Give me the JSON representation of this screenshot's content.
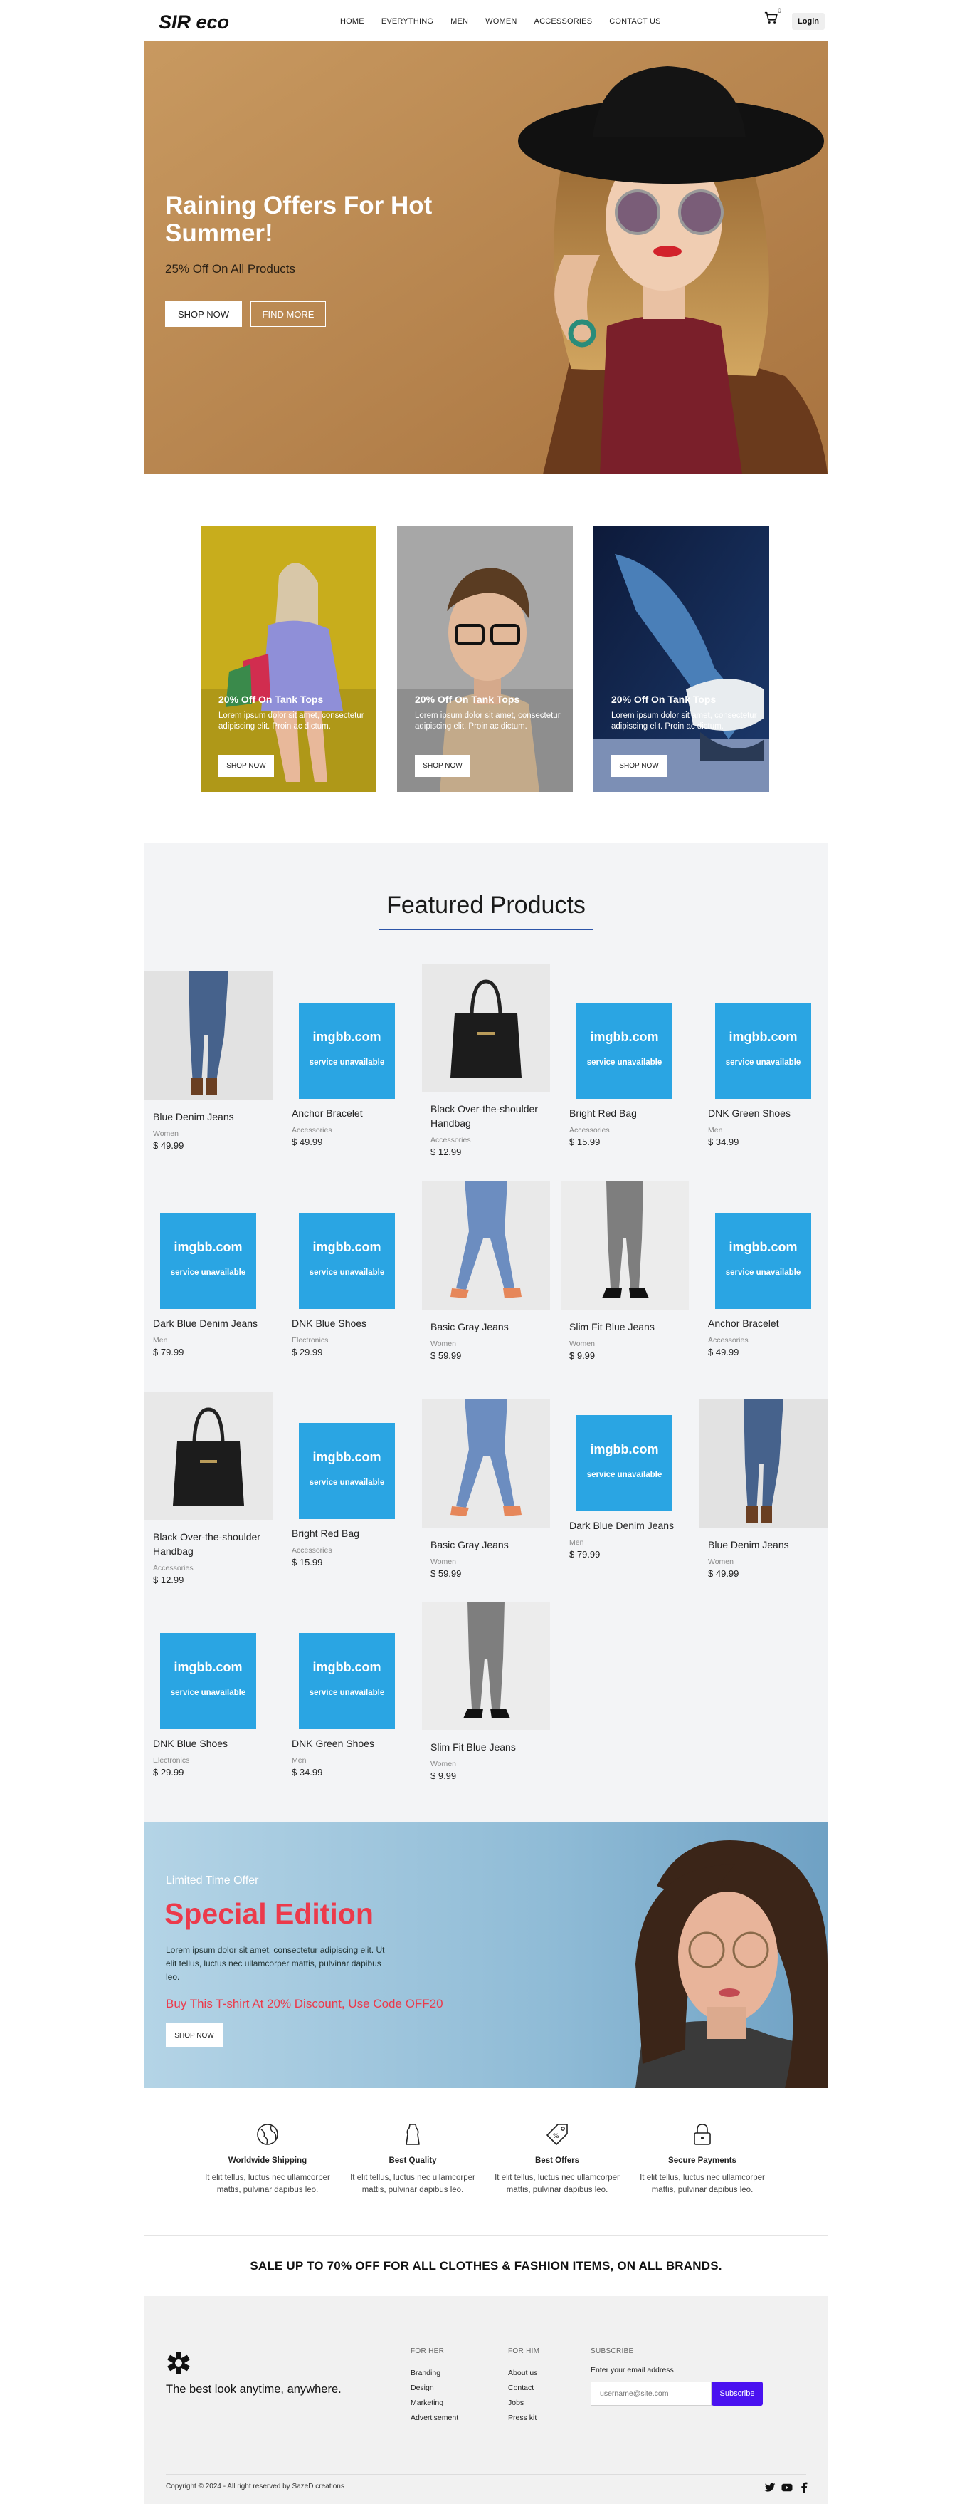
{
  "nav": {
    "logo": "SIR eco",
    "menu": [
      "HOME",
      "EVERYTHING",
      "MEN",
      "WOMEN",
      "ACCESSORIES",
      "CONTACT US"
    ],
    "cart_count": "0",
    "login": "Login"
  },
  "hero": {
    "title": "Raining Offers For Hot Summer!",
    "subtitle": "25% Off On All Products",
    "shop_now": "SHOP NOW",
    "find_more": "FIND MORE"
  },
  "promos": [
    {
      "title": "20% Off On Tank Tops",
      "text": "Lorem ipsum dolor sit amet, consectetur adipiscing elit. Proin ac dictum.",
      "button": "SHOP NOW"
    },
    {
      "title": "20% Off On Tank Tops",
      "text": "Lorem ipsum dolor sit amet, consectetur adipiscing elit. Proin ac dictum.",
      "button": "SHOP NOW"
    },
    {
      "title": "20% Off On Tank Tops",
      "text": "Lorem ipsum dolor sit amet, consectetur adipiscing elit. Proin ac dictum.",
      "button": "SHOP NOW"
    }
  ],
  "featured": {
    "title": "Featured Products",
    "placeholder_line1": "imgbb.com",
    "placeholder_line2": "service unavailable",
    "products": [
      {
        "name": "Blue Denim Jeans",
        "category": "Women",
        "price": "$ 49.99",
        "image": "jeans-brown-boots"
      },
      {
        "name": "Anchor Bracelet",
        "category": "Accessories",
        "price": "$ 49.99",
        "image": "placeholder"
      },
      {
        "name": "Black Over-the-shoulder Handbag",
        "category": "Accessories",
        "price": "$ 12.99",
        "image": "black-handbag"
      },
      {
        "name": "Bright Red Bag",
        "category": "Accessories",
        "price": "$ 15.99",
        "image": "placeholder"
      },
      {
        "name": "DNK Green Shoes",
        "category": "Men",
        "price": "$ 34.99",
        "image": "placeholder"
      },
      {
        "name": "Dark Blue Denim Jeans",
        "category": "Men",
        "price": "$ 79.99",
        "image": "placeholder"
      },
      {
        "name": "DNK Blue Shoes",
        "category": "Electronics",
        "price": "$ 29.99",
        "image": "placeholder"
      },
      {
        "name": "Basic Gray Jeans",
        "category": "Women",
        "price": "$ 59.99",
        "image": "jeans-orange-heels"
      },
      {
        "name": "Slim Fit Blue Jeans",
        "category": "Women",
        "price": "$ 9.99",
        "image": "gray-jeans-black-heels"
      },
      {
        "name": "Anchor Bracelet",
        "category": "Accessories",
        "price": "$ 49.99",
        "image": "placeholder"
      },
      {
        "name": "Black Over-the-shoulder Handbag",
        "category": "Accessories",
        "price": "$ 12.99",
        "image": "black-handbag"
      },
      {
        "name": "Bright Red Bag",
        "category": "Accessories",
        "price": "$ 15.99",
        "image": "placeholder"
      },
      {
        "name": "Basic Gray Jeans",
        "category": "Women",
        "price": "$ 59.99",
        "image": "jeans-orange-heels"
      },
      {
        "name": "Dark Blue Denim Jeans",
        "category": "Men",
        "price": "$ 79.99",
        "image": "placeholder"
      },
      {
        "name": "Blue Denim Jeans",
        "category": "Women",
        "price": "$ 49.99",
        "image": "jeans-brown-boots"
      },
      {
        "name": "DNK Blue Shoes",
        "category": "Electronics",
        "price": "$ 29.99",
        "image": "placeholder"
      },
      {
        "name": "DNK Green Shoes",
        "category": "Men",
        "price": "$ 34.99",
        "image": "placeholder"
      },
      {
        "name": "Slim Fit Blue Jeans",
        "category": "Women",
        "price": "$ 9.99",
        "image": "gray-jeans-black-heels"
      }
    ]
  },
  "special": {
    "limited": "Limited Time Offer",
    "title": "Special Edition",
    "text": "Lorem ipsum dolor sit amet, consectetur adipiscing elit. Ut elit tellus, luctus nec ullamcorper mattis, pulvinar dapibus leo.",
    "offer": "Buy This T-shirt At 20% Discount, Use Code OFF20",
    "button": "SHOP NOW"
  },
  "features": [
    {
      "icon": "globe-icon",
      "title": "Worldwide Shipping",
      "text": "It elit tellus, luctus nec ullamcorper mattis, pulvinar dapibus leo."
    },
    {
      "icon": "shirt-icon",
      "title": "Best Quality",
      "text": "It elit tellus, luctus nec ullamcorper mattis, pulvinar dapibus leo."
    },
    {
      "icon": "tag-icon",
      "title": "Best Offers",
      "text": "It elit tellus, luctus nec ullamcorper mattis, pulvinar dapibus leo."
    },
    {
      "icon": "lock-icon",
      "title": "Secure Payments",
      "text": "It elit tellus, luctus nec ullamcorper mattis, pulvinar dapibus leo."
    }
  ],
  "sale_banner": "SALE UP TO 70% OFF FOR ALL CLOTHES & FASHION ITEMS, ON ALL BRANDS.",
  "footer": {
    "tagline": "The best look anytime, anywhere.",
    "for_her": {
      "heading": "FOR HER",
      "links": [
        "Branding",
        "Design",
        "Marketing",
        "Advertisement"
      ]
    },
    "for_him": {
      "heading": "FOR HIM",
      "links": [
        "About us",
        "Contact",
        "Jobs",
        "Press kit"
      ]
    },
    "subscribe": {
      "heading": "SUBSCRIBE",
      "label": "Enter your email address",
      "placeholder": "username@site.com",
      "button": "Subscribe"
    },
    "copyright": "Copyright © 2024 - All right reserved by SazeD creations"
  },
  "colors": {
    "accent_red": "#ec3a4b",
    "subscribe_purple": "#4a12f0",
    "title_underline": "#2c54a8",
    "placeholder_blue": "#2aa5e3"
  }
}
